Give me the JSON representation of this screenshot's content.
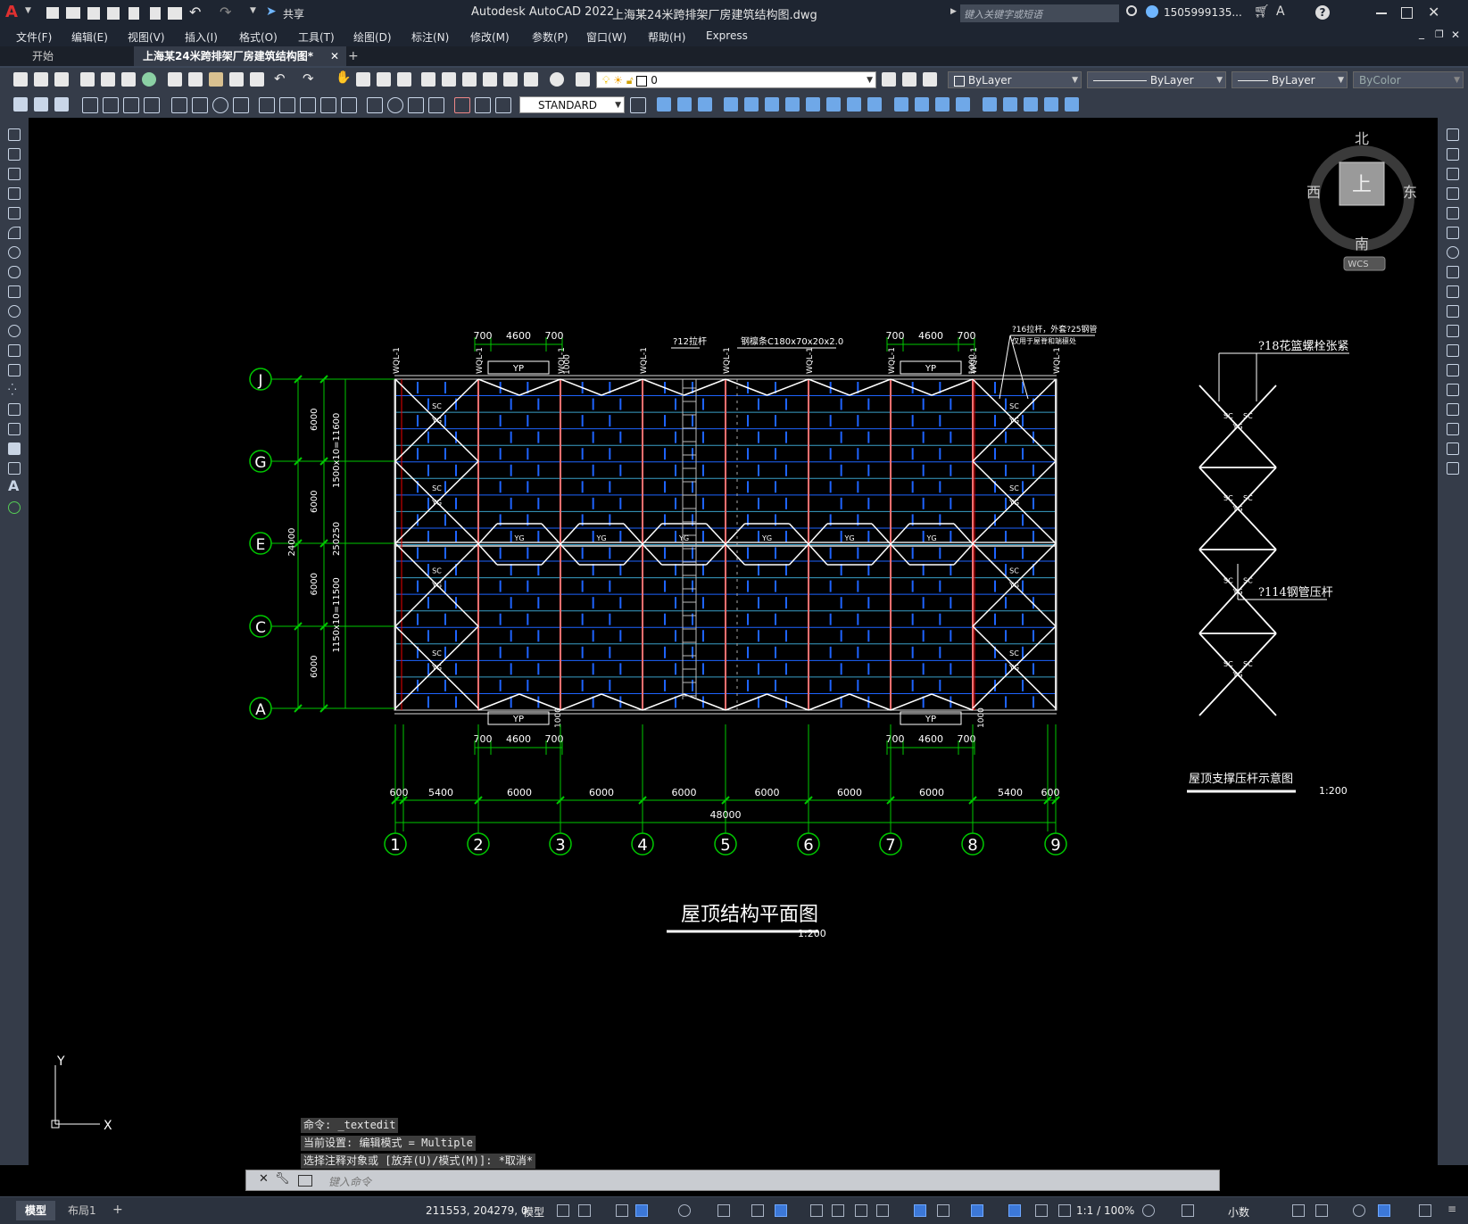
{
  "title": {
    "app_title": "Autodesk AutoCAD 2022",
    "file_title": "上海某24米跨排架厂房建筑结构图.dwg",
    "share_label": "共享",
    "search_placeholder": "键入关键字或短语",
    "user": "1505999135...",
    "app_letter": "A"
  },
  "menu": [
    "文件(F)",
    "编辑(E)",
    "视图(V)",
    "插入(I)",
    "格式(O)",
    "工具(T)",
    "绘图(D)",
    "标注(N)",
    "修改(M)",
    "参数(P)",
    "窗口(W)",
    "帮助(H)",
    "Express"
  ],
  "tabs": {
    "start": "开始",
    "active": "上海某24米跨排架厂房建筑结构图*",
    "close": "✕",
    "add": "+"
  },
  "toolbar": {
    "layer_value": "0",
    "color_value": "ByLayer",
    "linetype_value": "ByLayer",
    "lineweight_value": "ByLayer",
    "plotstyle_value": "ByColor",
    "textstyle_value": "STANDARD"
  },
  "viewcube": {
    "north": "北",
    "south": "南",
    "east": "东",
    "west": "西",
    "top": "上",
    "wcs": "WCS"
  },
  "drawing": {
    "plan_title": "屋顶结构平面图",
    "plan_scale": "1:200",
    "detail_title": "屋顶支撑压杆示意图",
    "detail_scale": "1:200",
    "grid_cols": [
      "1",
      "2",
      "3",
      "4",
      "5",
      "6",
      "7",
      "8",
      "9"
    ],
    "grid_rows": [
      "J",
      "G",
      "E",
      "C",
      "A"
    ],
    "bottom_dims": [
      "600",
      "5400",
      "6000",
      "6000",
      "6000",
      "6000",
      "6000",
      "6000",
      "5400",
      "600"
    ],
    "total_dim": "48000",
    "left_dims": [
      "6000",
      "6000",
      "6000",
      "6000"
    ],
    "left_total": "24000",
    "left_inner_top": "1500x10=11600",
    "left_inner_mid": "250250",
    "left_inner_bottom": "1150x10=11500",
    "top_dim_a": [
      "700",
      "4600",
      "700"
    ],
    "top_dim_b": [
      "700",
      "4600",
      "700"
    ],
    "yp": "YP",
    "yg": "YG",
    "sc": "SC",
    "wql": "WQL-1",
    "dim_1000": "1000",
    "ann_tie": "?12拉杆",
    "ann_purlin": "钢檩条C180x70x20x2.0",
    "ann_rod16": "?16拉杆，外套?25钢管",
    "ann_rod16b": "仅用于屋脊和端檩处",
    "ann_bolt": "?18花篮螺栓张紧",
    "ann_pipe": "?114钢管压杆"
  },
  "command": {
    "line1": "命令: _textedit",
    "line2": "当前设置: 编辑模式 = Multiple",
    "line3": "选择注释对象或 [放弃(U)/模式(M)]: *取消*",
    "input_placeholder": "键入命令"
  },
  "ucs": {
    "x": "X",
    "y": "Y"
  },
  "status": {
    "model_tab": "模型",
    "layout_tab": "布局1",
    "add_tab": "+",
    "coords": "211553, 204279, 0",
    "model": "模型",
    "scale": "1:1 / 100%",
    "units": "小数"
  },
  "colors": {
    "grid_line": "#00c800",
    "purlin_blue": "#1e64ff",
    "rafter_red": "#ff7070",
    "brace_white": "#ffffff",
    "titlebar": "#1e2531",
    "toolbar": "#353c49"
  }
}
